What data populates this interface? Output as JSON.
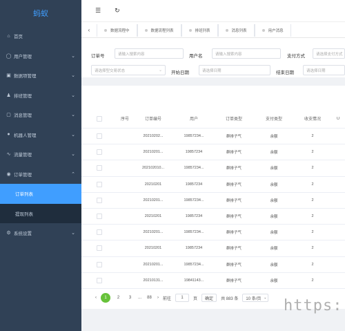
{
  "app": {
    "logo": "蚂蚁"
  },
  "sidebar": {
    "items": [
      {
        "icon": "dashboard-icon",
        "glyph": "⌂",
        "label": "首页",
        "has_arrow": false
      },
      {
        "icon": "user-icon",
        "glyph": "◯",
        "label": "用户管理",
        "has_arrow": true
      },
      {
        "icon": "list-icon",
        "glyph": "▣",
        "label": "数据项管理",
        "has_arrow": true
      },
      {
        "icon": "team-icon",
        "glyph": "♟",
        "label": "排班管理",
        "has_arrow": true
      },
      {
        "icon": "doc-icon",
        "glyph": "▢",
        "label": "消息管理",
        "has_arrow": true
      },
      {
        "icon": "robot-icon",
        "glyph": "●",
        "label": "机器人管理",
        "has_arrow": true
      },
      {
        "icon": "chart-icon",
        "glyph": "∿",
        "label": "流量管理",
        "has_arrow": true
      },
      {
        "icon": "order-icon",
        "glyph": "◉",
        "label": "订单管理",
        "has_arrow": true,
        "expanded": true
      }
    ],
    "sub_items": [
      {
        "label": "订单列表",
        "active": true
      },
      {
        "label": "提现列表",
        "active": false
      }
    ],
    "last_item": {
      "icon": "settings-icon",
      "glyph": "⚙",
      "label": "系统设置"
    }
  },
  "topbar": {
    "menu_icon": "☰",
    "refresh_icon": "↻"
  },
  "tabs": {
    "left_arrow": "‹",
    "items": [
      "数据流程中",
      "数据流程列表",
      "排班列表",
      "消息列表",
      "用户消息"
    ]
  },
  "filter": {
    "order_no_label": "订单号",
    "order_no_placeholder": "请输入搜索内容",
    "username_label": "用户名",
    "username_placeholder": "请输入搜索内容",
    "pay_label": "支付方式",
    "pay_placeholder": "请选择支付方式",
    "type_placeholder": "请选择型交易状态",
    "start_label": "开始日期",
    "start_placeholder": "请选择日期",
    "end_label": "结束日期",
    "end_placeholder": "请选择日期"
  },
  "table": {
    "headers": [
      "序号",
      "订单编号",
      "用户",
      "订单类型",
      "支付类型",
      "收支情况",
      "U"
    ],
    "rows": [
      {
        "no": "20210202...",
        "user": "19857234...",
        "type": "群排子气",
        "pay": "余额",
        "ret": "2"
      },
      {
        "no": "20210201...",
        "user": "19857234",
        "type": "群排子气",
        "pay": "余额",
        "ret": "2"
      },
      {
        "no": "202102010...",
        "user": "19857234...",
        "type": "群排子气",
        "pay": "余额",
        "ret": "2"
      },
      {
        "no": "20210201",
        "user": "19857234",
        "type": "群排子气",
        "pay": "余额",
        "ret": "2"
      },
      {
        "no": "20210201...",
        "user": "19857234...",
        "type": "群排子气",
        "pay": "余额",
        "ret": "2"
      },
      {
        "no": "20210201",
        "user": "19857234",
        "type": "群排子气",
        "pay": "余额",
        "ret": "2"
      },
      {
        "no": "20210201...",
        "user": "19857234...",
        "type": "群排子气",
        "pay": "余额",
        "ret": "2"
      },
      {
        "no": "20210201",
        "user": "19857234",
        "type": "群排子气",
        "pay": "余额",
        "ret": "2"
      },
      {
        "no": "20210201...",
        "user": "19857234...",
        "type": "群排子气",
        "pay": "余额",
        "ret": "2"
      },
      {
        "no": "20210131...",
        "user": "19841143...",
        "type": "群排子气",
        "pay": "余额",
        "ret": "2"
      }
    ]
  },
  "pagination": {
    "prev": "‹",
    "pages": [
      "1",
      "2",
      "3"
    ],
    "ellipsis": "...",
    "last_page": "88",
    "next": "›",
    "goto_label": "前往",
    "goto_value": "1",
    "page_unit": "页",
    "confirm": "确定",
    "total": "共 883 条",
    "page_size": "10 条/页"
  },
  "watermark": "https:"
}
